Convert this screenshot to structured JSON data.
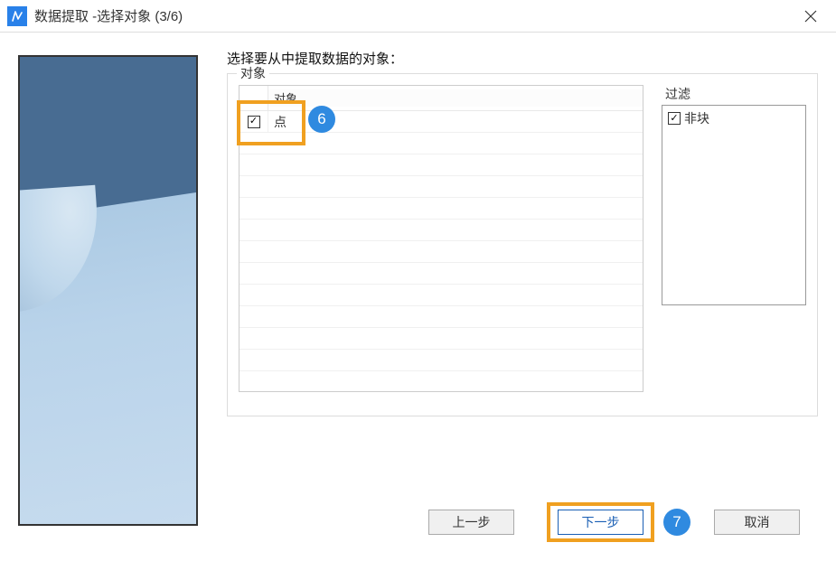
{
  "title": "数据提取 -选择对象 (3/6)",
  "instruction": "选择要从中提取数据的对象：",
  "groupbox_label": "对象",
  "object_header": "对象",
  "objects": [
    {
      "label": "点",
      "checked": true
    }
  ],
  "filter_label": "过滤",
  "filters": [
    {
      "label": "非块",
      "checked": true
    }
  ],
  "buttons": {
    "prev": "上一步",
    "next": "下一步",
    "cancel": "取消"
  },
  "annotations": {
    "badge6": "6",
    "badge7": "7"
  }
}
